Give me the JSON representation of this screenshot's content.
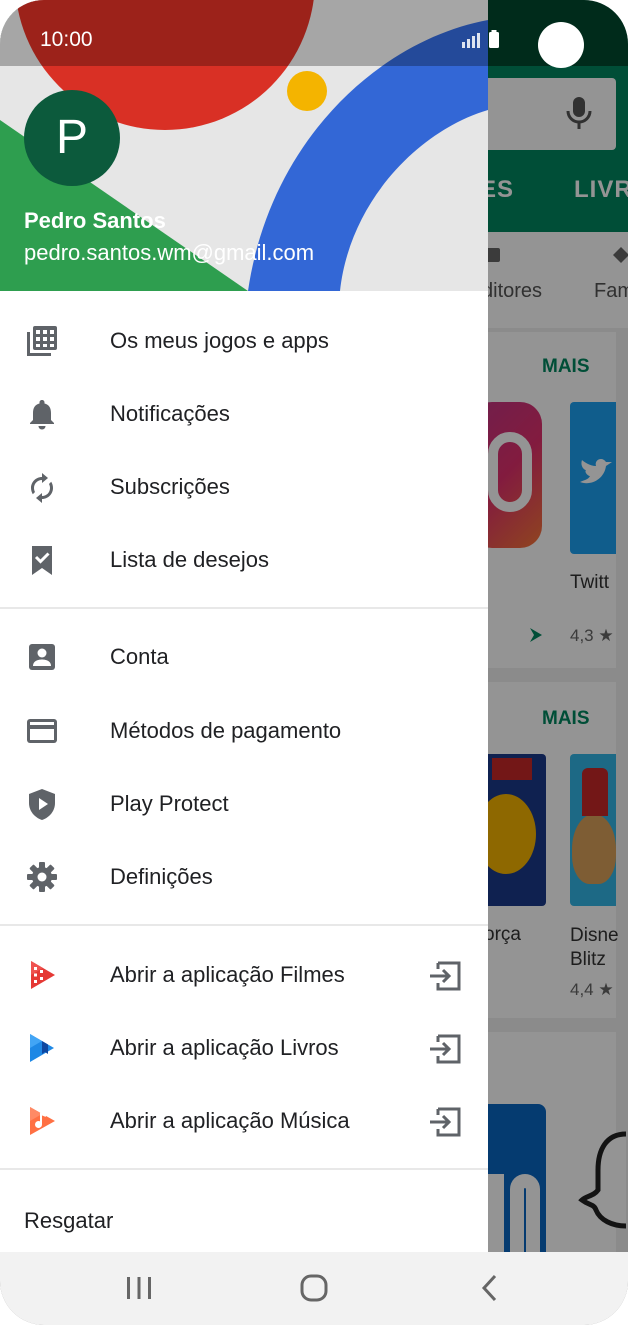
{
  "status_bar": {
    "time": "10:00"
  },
  "background": {
    "tabs": [
      "ES",
      "LIVR"
    ],
    "chips": [
      "ditores",
      "Fam"
    ],
    "sections": [
      {
        "more_label": "MAIS",
        "app_name": "Twitt",
        "rating": "4,3 ★"
      },
      {
        "more_label": "MAIS",
        "app_names": [
          "orça",
          "Disne Blitz"
        ],
        "rating": "4,4 ★"
      }
    ]
  },
  "account": {
    "avatar_letter": "P",
    "name": "Pedro Santos",
    "email": "pedro.santos.wm@gmail.com"
  },
  "menu": {
    "group1": [
      {
        "label": "Os meus jogos e apps",
        "icon": "apps-grid-icon"
      },
      {
        "label": "Notificações",
        "icon": "bell-icon"
      },
      {
        "label": "Subscrições",
        "icon": "refresh-icon"
      },
      {
        "label": "Lista de desejos",
        "icon": "bookmark-check-icon"
      }
    ],
    "group2": [
      {
        "label": "Conta",
        "icon": "account-box-icon"
      },
      {
        "label": "Métodos de pagamento",
        "icon": "credit-card-icon"
      },
      {
        "label": "Play Protect",
        "icon": "shield-play-icon"
      },
      {
        "label": "Definições",
        "icon": "gear-icon"
      }
    ],
    "group3": [
      {
        "label": "Abrir a aplicação Filmes",
        "icon": "play-movies-icon"
      },
      {
        "label": "Abrir a aplicação Livros",
        "icon": "play-books-icon"
      },
      {
        "label": "Abrir a aplicação Música",
        "icon": "play-music-icon"
      }
    ],
    "redeem_label": "Resgatar"
  },
  "colors": {
    "brand_green": "#01875f",
    "header_red": "#d93025",
    "header_blue": "#3367d6",
    "header_yellow": "#f4b400",
    "header_green": "#2e9e4f"
  }
}
